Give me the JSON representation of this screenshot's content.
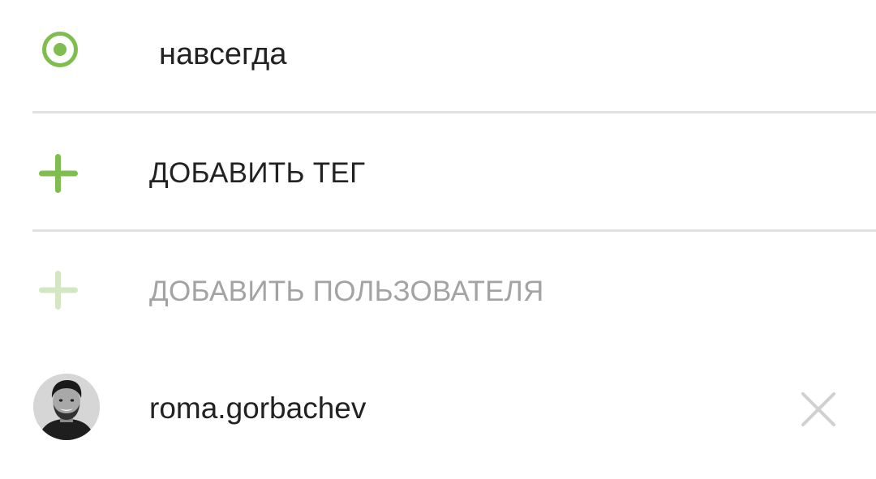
{
  "expiration": {
    "option_label": "навсегда",
    "selected": true
  },
  "add_tag": {
    "label": "ДОБАВИТЬ ТЕГ",
    "icon": "plus-icon"
  },
  "add_user": {
    "label": "ДОБАВИТЬ ПОЛЬЗОВАТЕЛЯ",
    "icon": "plus-icon",
    "enabled": false
  },
  "users": [
    {
      "username": "roma.gorbachev",
      "remove_icon": "close-icon"
    }
  ],
  "colors": {
    "accent": "#7fbd4e",
    "accent_disabled": "#d3e8c2",
    "text_primary": "#222222",
    "text_disabled": "#a3a3a3",
    "divider": "#e1e1e1",
    "remove_icon": "#d0d0d0"
  }
}
